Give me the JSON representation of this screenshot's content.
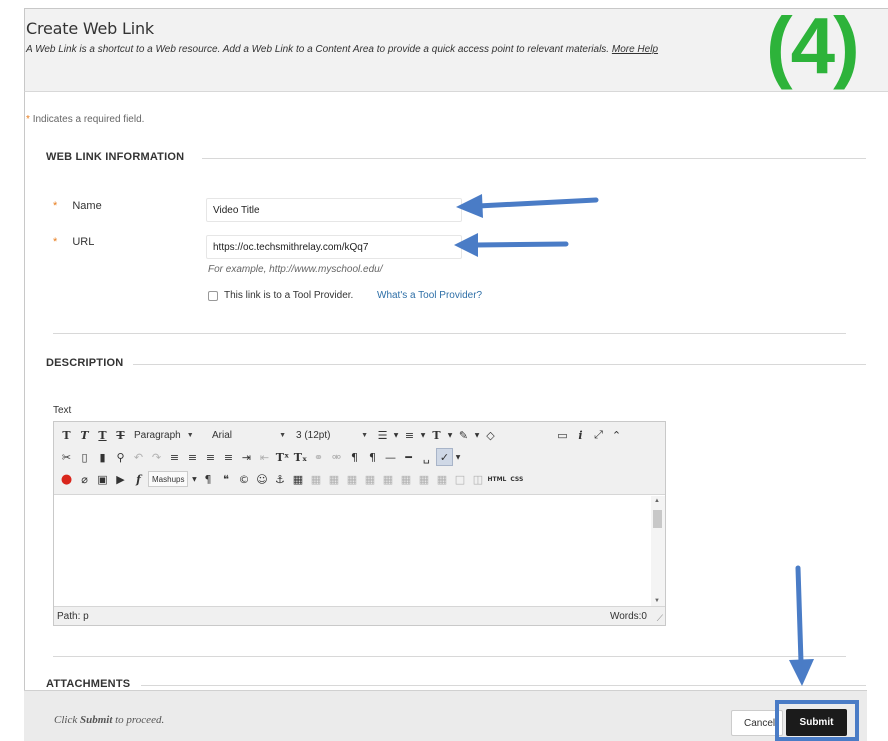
{
  "header": {
    "title": "Create Web Link",
    "description": "A Web Link is a shortcut to a Web resource. Add a Web Link to a Content Area to provide a quick access point to relevant materials.",
    "more_help": "More Help"
  },
  "step_label": "(4)",
  "required_note": {
    "star": "*",
    "text": "Indicates a required field."
  },
  "web_link_section": {
    "heading": "WEB LINK INFORMATION",
    "name": {
      "label": "Name",
      "value": "Video Title"
    },
    "url": {
      "label": "URL",
      "value": "https://oc.techsmithrelay.com/kQq7",
      "hint": "For example, http://www.myschool.edu/"
    },
    "tool_provider": {
      "label": "This link is to a Tool Provider.",
      "link": "What's a Tool Provider?",
      "checked": false
    }
  },
  "description_section": {
    "heading": "DESCRIPTION",
    "text_label": "Text",
    "toolbar": {
      "row1": {
        "format": "Paragraph",
        "font": "Arial",
        "size": "3 (12pt)"
      },
      "row3": {
        "mashups": "Mashups",
        "html": "HTML",
        "css": "CSS"
      }
    },
    "status": {
      "path": "Path: p",
      "words": "Words:0"
    }
  },
  "attachments_section": {
    "heading": "ATTACHMENTS"
  },
  "footer": {
    "proceed_prefix": "Click ",
    "proceed_bold": "Submit",
    "proceed_suffix": " to proceed.",
    "cancel_label": "Cancel",
    "submit_label": "Submit"
  },
  "colors": {
    "required_star": "#e87d1e",
    "link": "#2e6fa7",
    "annotation_arrow": "#4a7cc6",
    "step_label": "#2db33a",
    "submit_bg": "#1b1b1b"
  },
  "icons": [
    "bold-icon",
    "italic-icon",
    "underline-icon",
    "strikethrough-icon",
    "cut-icon",
    "copy-icon",
    "paste-icon",
    "find-icon",
    "undo-icon",
    "redo-icon",
    "align-left-icon",
    "align-center-icon",
    "align-right-icon",
    "justify-icon",
    "indent-icon",
    "outdent-icon",
    "superscript-icon",
    "subscript-icon",
    "link-icon",
    "unlink-icon",
    "spellcheck-icon",
    "record-icon",
    "attach-icon",
    "image-icon",
    "media-icon",
    "math-icon",
    "paragraph-icon",
    "quote-icon",
    "copyright-icon",
    "emoji-icon",
    "anchor-icon",
    "table-icon",
    "preview-icon",
    "info-icon",
    "fullscreen-icon",
    "collapse-icon"
  ]
}
